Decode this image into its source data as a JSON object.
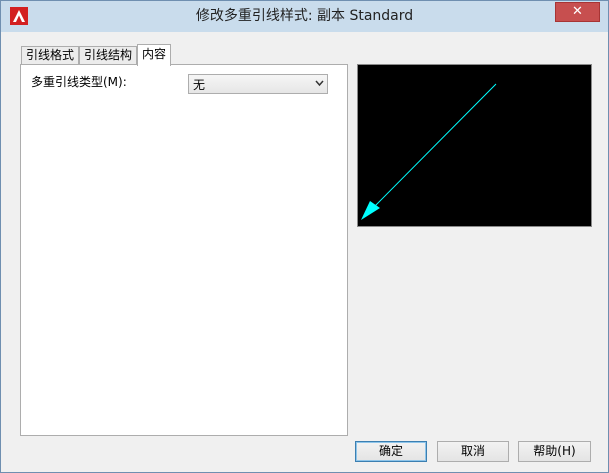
{
  "window": {
    "title": "修改多重引线样式: 副本 Standard"
  },
  "title_controls": {
    "close_glyph": "✕"
  },
  "tabs": [
    {
      "label": "引线格式"
    },
    {
      "label": "引线结构"
    },
    {
      "label": "内容",
      "active": true
    }
  ],
  "content": {
    "leader_type_label": "多重引线类型(M):",
    "leader_type_value": "无"
  },
  "preview": {
    "background": "#000000",
    "leader_color": "#00ffff"
  },
  "buttons": {
    "ok": "确定",
    "cancel": "取消",
    "help": "帮助(H)"
  },
  "colors": {
    "app_icon": "#d32020"
  }
}
